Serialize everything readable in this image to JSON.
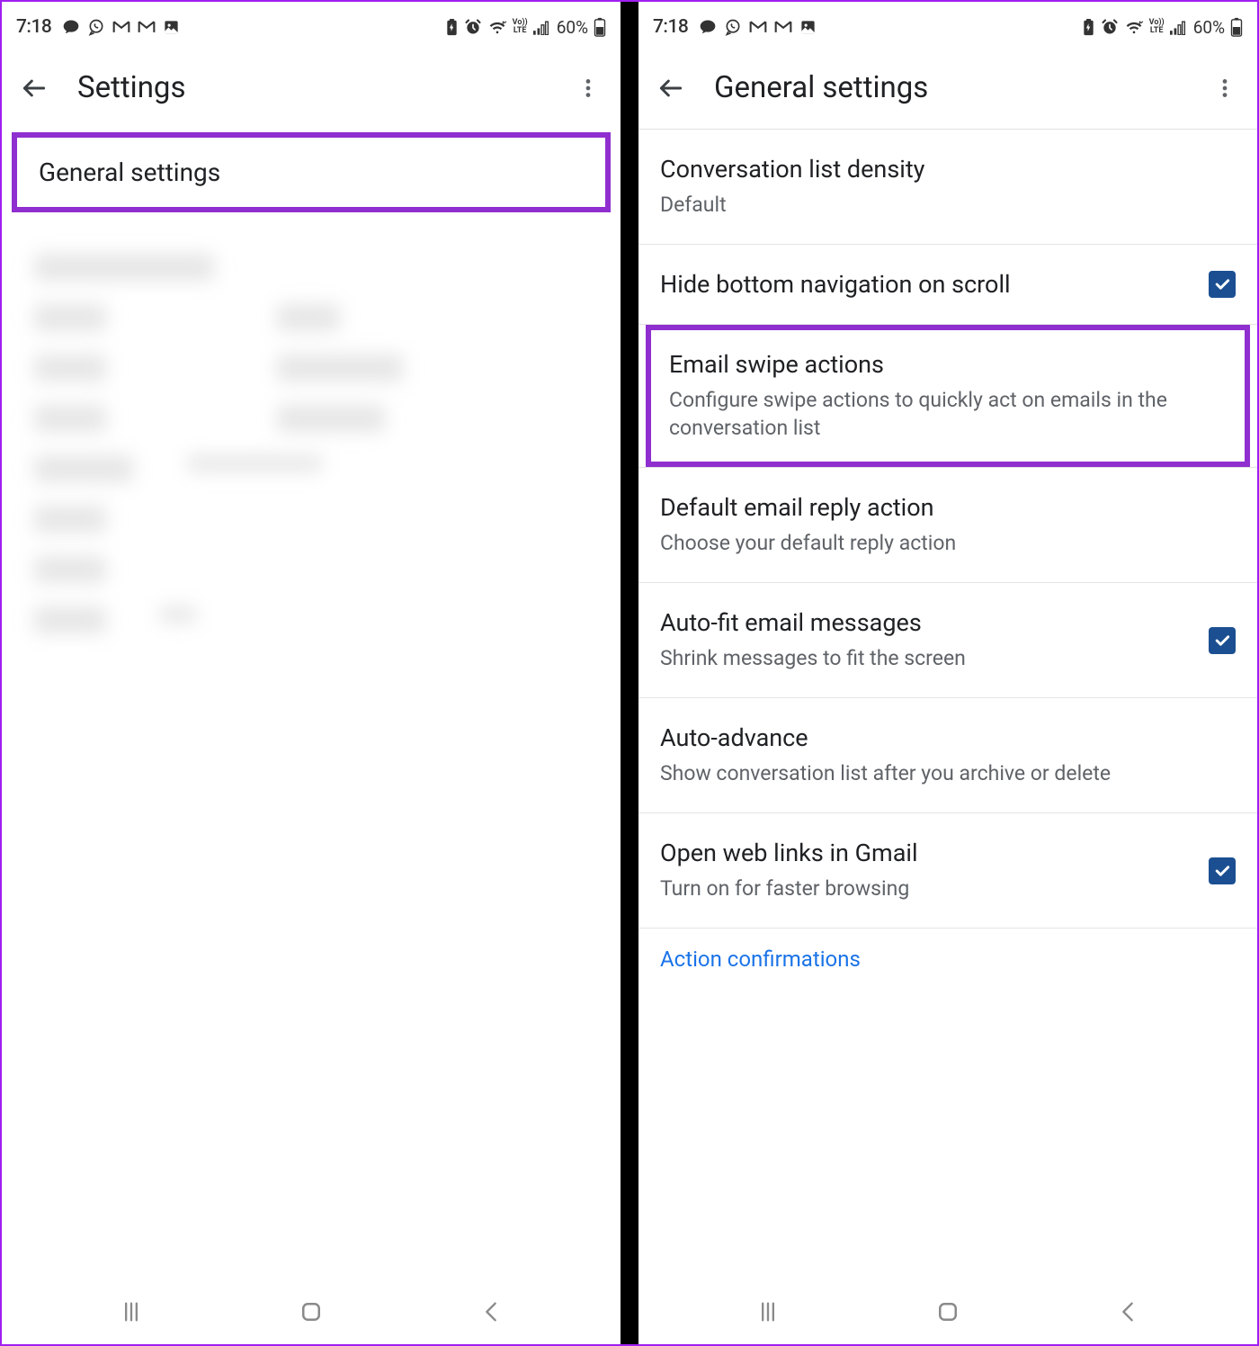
{
  "status": {
    "time": "7:18",
    "battery_pct": "60%"
  },
  "left": {
    "title": "Settings",
    "general_settings": "General settings"
  },
  "right": {
    "title": "General settings",
    "items": {
      "density": {
        "title": "Conversation list density",
        "sub": "Default"
      },
      "hide_nav": {
        "title": "Hide bottom navigation on scroll"
      },
      "swipe": {
        "title": "Email swipe actions",
        "sub": "Configure swipe actions to quickly act on emails in the conversation list"
      },
      "reply": {
        "title": "Default email reply action",
        "sub": "Choose your default reply action"
      },
      "autofit": {
        "title": "Auto-fit email messages",
        "sub": "Shrink messages to fit the screen"
      },
      "advance": {
        "title": "Auto-advance",
        "sub": "Show conversation list after you archive or delete"
      },
      "weblinks": {
        "title": "Open web links in Gmail",
        "sub": "Turn on for faster browsing"
      },
      "section_action": "Action confirmations"
    }
  }
}
